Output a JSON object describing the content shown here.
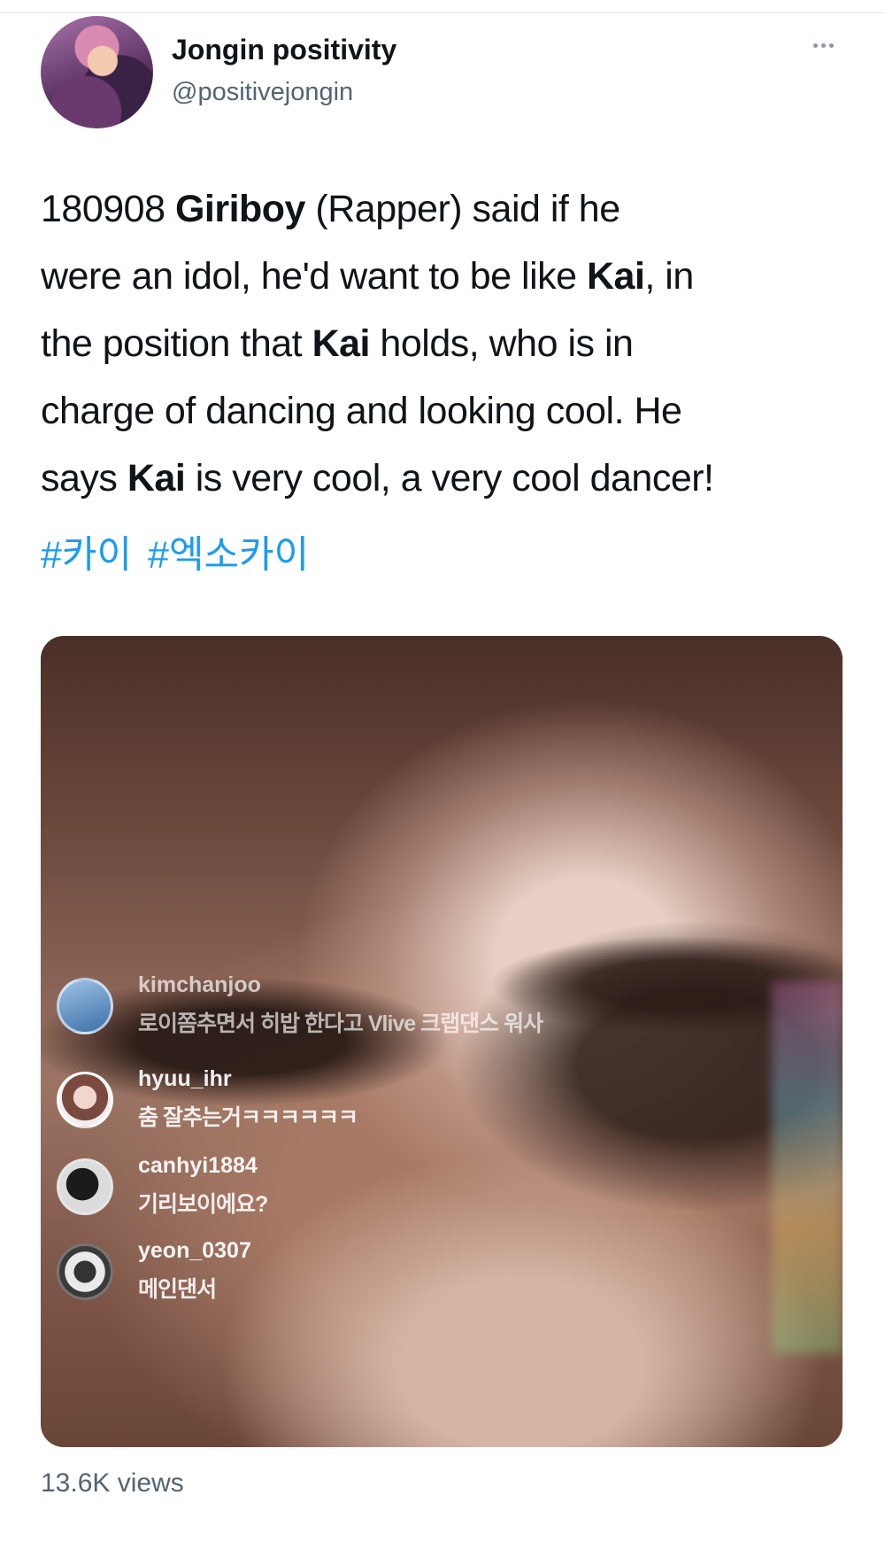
{
  "author": {
    "display_name": "Jongin positivity",
    "handle": "@positivejongin"
  },
  "tweet": {
    "lines": [
      [
        {
          "t": "180908 "
        },
        {
          "t": "Giriboy",
          "b": true
        },
        {
          "t": " (Rapper) said if he"
        }
      ],
      [
        {
          "t": "were an idol, he'd want to be like "
        },
        {
          "t": "Kai",
          "b": true
        },
        {
          "t": ", in"
        }
      ],
      [
        {
          "t": "the position that "
        },
        {
          "t": "Kai",
          "b": true
        },
        {
          "t": " holds, who is in"
        }
      ],
      [
        {
          "t": "charge of dancing and looking cool. He"
        }
      ],
      [
        {
          "t": "says "
        },
        {
          "t": "Kai",
          "b": true
        },
        {
          "t": " is very cool, a very cool dancer!"
        }
      ]
    ],
    "hashtags": [
      "#카이",
      "#엑소카이"
    ]
  },
  "media": {
    "comments": [
      {
        "user": "kimchanjoo",
        "message": "로이쫌추면서 히밥 한다고 Vlive 크랩댄스 워사"
      },
      {
        "user": "hyuu_ihr",
        "message": "춤 잘추는거ㅋㅋㅋㅋㅋㅋ"
      },
      {
        "user": "canhyi1884",
        "message": "기리보이에요?"
      },
      {
        "user": "yeon_0307",
        "message": "메인댄서"
      }
    ]
  },
  "stats": {
    "views": "13.6K views"
  },
  "colors": {
    "link": "#1d9bf0",
    "secondary_text": "#536471"
  },
  "icons": {
    "more": "more-horizontal-icon"
  }
}
